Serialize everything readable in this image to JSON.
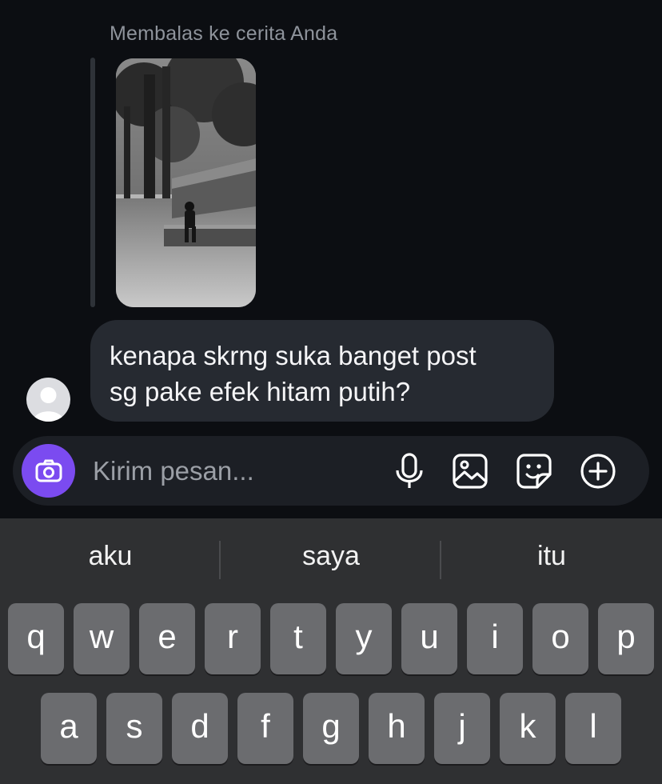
{
  "reply_context": "Membalas ke cerita Anda",
  "message": {
    "line1": "kenapa skrng suka banget post",
    "line2": "sg pake efek hitam putih?"
  },
  "composer": {
    "placeholder": "Kirim pesan...",
    "icons": [
      "camera-icon",
      "microphone-icon",
      "gallery-icon",
      "sticker-icon",
      "plus-icon"
    ]
  },
  "suggestions": [
    "aku",
    "saya",
    "itu"
  ],
  "keyboard": {
    "row1": [
      "q",
      "w",
      "e",
      "r",
      "t",
      "y",
      "u",
      "i",
      "o",
      "p"
    ],
    "row2": [
      "a",
      "s",
      "d",
      "f",
      "g",
      "h",
      "j",
      "k",
      "l"
    ]
  },
  "colors": {
    "background": "#0c0e12",
    "bubble": "#262a31",
    "camera_button": "#7b4bf0",
    "key": "#6b6c6f"
  }
}
